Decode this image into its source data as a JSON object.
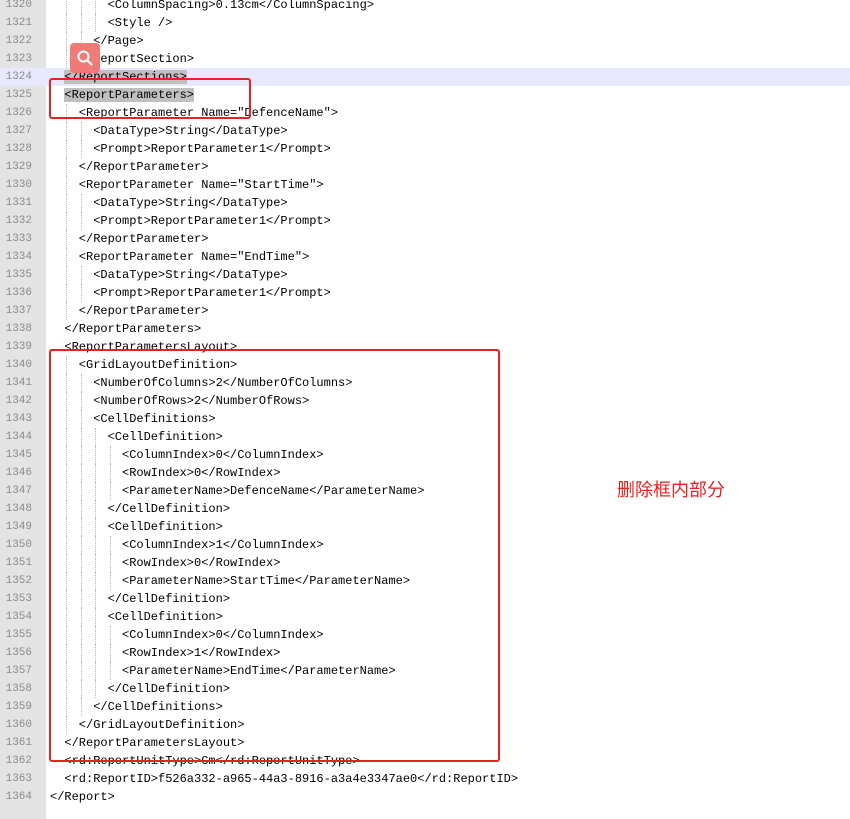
{
  "editor": {
    "lines": [
      {
        "number": "1320",
        "indent": 4,
        "text": "<ColumnSpacing>0.13cm</ColumnSpacing>"
      },
      {
        "number": "1321",
        "indent": 4,
        "text": "<Style />"
      },
      {
        "number": "1322",
        "indent": 3,
        "text": "</Page>"
      },
      {
        "number": "1323",
        "indent": 2,
        "text": "</ReportSection>"
      },
      {
        "number": "1324",
        "indent": 1,
        "text": "</ReportSections>",
        "selected": true,
        "current": true
      },
      {
        "number": "1325",
        "indent": 1,
        "text": "<ReportParameters>",
        "selected": true
      },
      {
        "number": "1326",
        "indent": 2,
        "text": "<ReportParameter Name=\"DefenceName\">"
      },
      {
        "number": "1327",
        "indent": 3,
        "text": "<DataType>String</DataType>"
      },
      {
        "number": "1328",
        "indent": 3,
        "text": "<Prompt>ReportParameter1</Prompt>"
      },
      {
        "number": "1329",
        "indent": 2,
        "text": "</ReportParameter>"
      },
      {
        "number": "1330",
        "indent": 2,
        "text": "<ReportParameter Name=\"StartTime\">"
      },
      {
        "number": "1331",
        "indent": 3,
        "text": "<DataType>String</DataType>"
      },
      {
        "number": "1332",
        "indent": 3,
        "text": "<Prompt>ReportParameter1</Prompt>"
      },
      {
        "number": "1333",
        "indent": 2,
        "text": "</ReportParameter>"
      },
      {
        "number": "1334",
        "indent": 2,
        "text": "<ReportParameter Name=\"EndTime\">"
      },
      {
        "number": "1335",
        "indent": 3,
        "text": "<DataType>String</DataType>"
      },
      {
        "number": "1336",
        "indent": 3,
        "text": "<Prompt>ReportParameter1</Prompt>"
      },
      {
        "number": "1337",
        "indent": 2,
        "text": "</ReportParameter>"
      },
      {
        "number": "1338",
        "indent": 1,
        "text": "</ReportParameters>"
      },
      {
        "number": "1339",
        "indent": 1,
        "text": "<ReportParametersLayout>"
      },
      {
        "number": "1340",
        "indent": 2,
        "text": "<GridLayoutDefinition>"
      },
      {
        "number": "1341",
        "indent": 3,
        "text": "<NumberOfColumns>2</NumberOfColumns>"
      },
      {
        "number": "1342",
        "indent": 3,
        "text": "<NumberOfRows>2</NumberOfRows>"
      },
      {
        "number": "1343",
        "indent": 3,
        "text": "<CellDefinitions>"
      },
      {
        "number": "1344",
        "indent": 4,
        "text": "<CellDefinition>"
      },
      {
        "number": "1345",
        "indent": 5,
        "text": "<ColumnIndex>0</ColumnIndex>"
      },
      {
        "number": "1346",
        "indent": 5,
        "text": "<RowIndex>0</RowIndex>"
      },
      {
        "number": "1347",
        "indent": 5,
        "text": "<ParameterName>DefenceName</ParameterName>"
      },
      {
        "number": "1348",
        "indent": 4,
        "text": "</CellDefinition>"
      },
      {
        "number": "1349",
        "indent": 4,
        "text": "<CellDefinition>"
      },
      {
        "number": "1350",
        "indent": 5,
        "text": "<ColumnIndex>1</ColumnIndex>"
      },
      {
        "number": "1351",
        "indent": 5,
        "text": "<RowIndex>0</RowIndex>"
      },
      {
        "number": "1352",
        "indent": 5,
        "text": "<ParameterName>StartTime</ParameterName>"
      },
      {
        "number": "1353",
        "indent": 4,
        "text": "</CellDefinition>"
      },
      {
        "number": "1354",
        "indent": 4,
        "text": "<CellDefinition>"
      },
      {
        "number": "1355",
        "indent": 5,
        "text": "<ColumnIndex>0</ColumnIndex>"
      },
      {
        "number": "1356",
        "indent": 5,
        "text": "<RowIndex>1</RowIndex>"
      },
      {
        "number": "1357",
        "indent": 5,
        "text": "<ParameterName>EndTime</ParameterName>"
      },
      {
        "number": "1358",
        "indent": 4,
        "text": "</CellDefinition>"
      },
      {
        "number": "1359",
        "indent": 3,
        "text": "</CellDefinitions>"
      },
      {
        "number": "1360",
        "indent": 2,
        "text": "</GridLayoutDefinition>"
      },
      {
        "number": "1361",
        "indent": 1,
        "text": "</ReportParametersLayout>"
      },
      {
        "number": "1362",
        "indent": 1,
        "text": "<rd:ReportUnitType>Cm</rd:ReportUnitType>"
      },
      {
        "number": "1363",
        "indent": 1,
        "text": "<rd:ReportID>f526a332-a965-44a3-8916-a3a4e3347ae0</rd:ReportID>"
      },
      {
        "number": "1364",
        "indent": 0,
        "text": "</Report>"
      }
    ]
  },
  "annotation": {
    "text": "删除框内部分"
  },
  "colors": {
    "annotation_red": "#e8231f",
    "gutter": "#e4e4e4",
    "selection": "#c0c0c0",
    "current_line": "#e8e8ff",
    "search_button": "#ef7a78"
  },
  "icons": {
    "search_button": "search-icon"
  }
}
